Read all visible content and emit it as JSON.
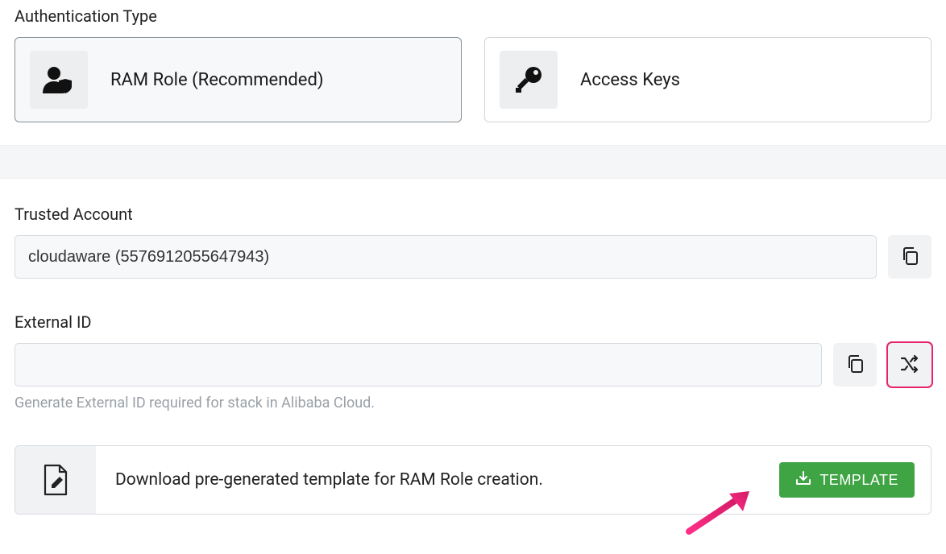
{
  "auth": {
    "heading": "Authentication Type",
    "option_ram_label": "RAM Role (Recommended)",
    "option_keys_label": "Access Keys"
  },
  "trusted_account": {
    "label": "Trusted Account",
    "value": "cloudaware (5576912055647943)"
  },
  "external_id": {
    "label": "External ID",
    "value": "",
    "helper": "Generate External ID required for stack in Alibaba Cloud."
  },
  "template": {
    "description": "Download pre-generated template for RAM Role creation.",
    "button_label": "TEMPLATE"
  }
}
